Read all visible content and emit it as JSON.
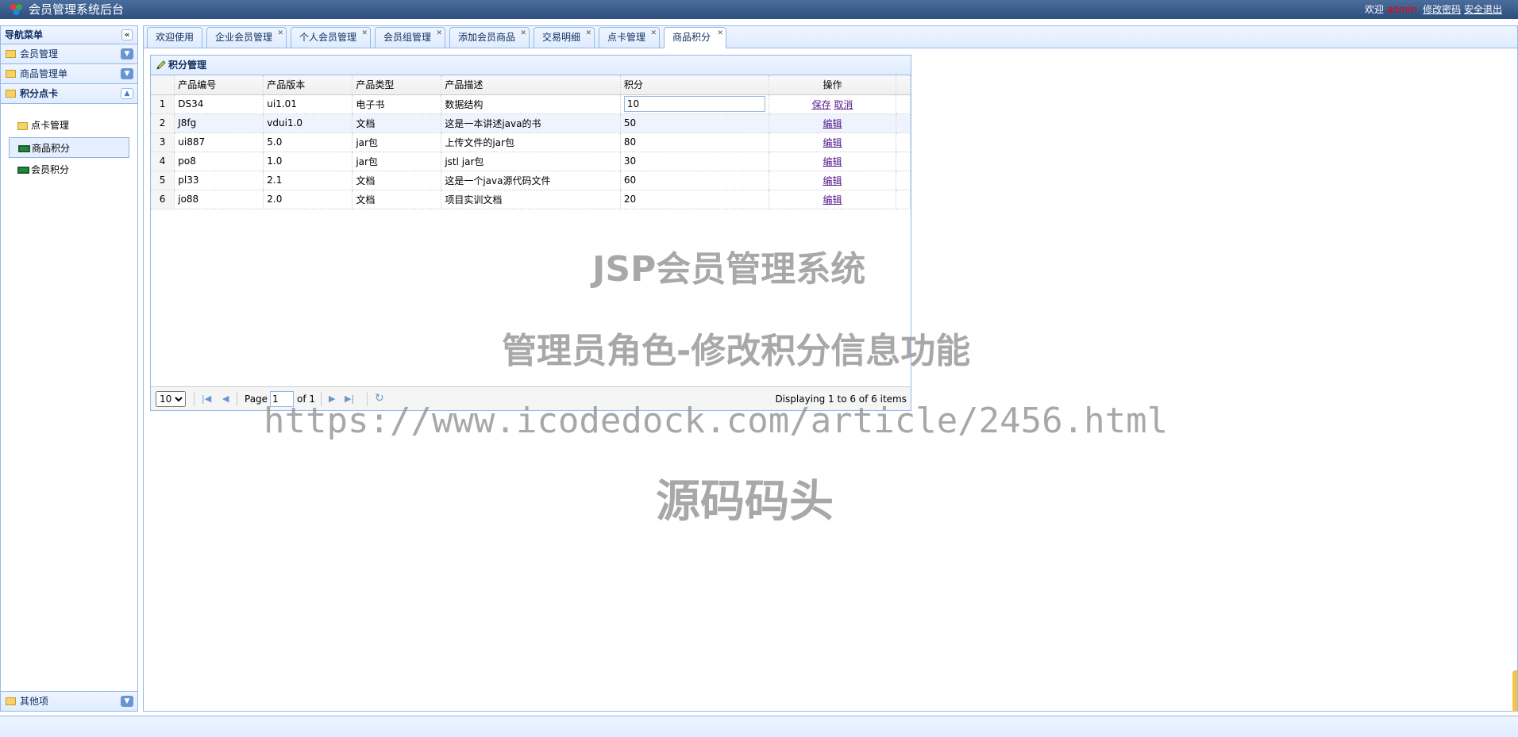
{
  "header": {
    "title": "会员管理系统后台",
    "welcome": "欢迎",
    "user": "admin",
    "change_password": "修改密码",
    "logout": "安全退出"
  },
  "nav": {
    "title": "导航菜单",
    "sections": [
      {
        "label": "会员管理"
      },
      {
        "label": "商品管理单"
      },
      {
        "label": "积分点卡"
      }
    ],
    "tree": [
      {
        "label": "点卡管理"
      },
      {
        "label": "商品积分"
      },
      {
        "label": "会员积分"
      }
    ],
    "other": "其他项"
  },
  "tabs": [
    {
      "label": "欢迎使用"
    },
    {
      "label": "企业会员管理"
    },
    {
      "label": "个人会员管理"
    },
    {
      "label": "会员组管理"
    },
    {
      "label": "添加会员商品"
    },
    {
      "label": "交易明细"
    },
    {
      "label": "点卡管理"
    },
    {
      "label": "商品积分"
    }
  ],
  "grid": {
    "title": "积分管理",
    "columns": [
      "产品编号",
      "产品版本",
      "产品类型",
      "产品描述",
      "积分",
      "操作"
    ],
    "rows": [
      {
        "n": "1",
        "code": "DS34",
        "version": "ui1.01",
        "type": "电子书",
        "desc": "数据结构",
        "points": "10"
      },
      {
        "n": "2",
        "code": "J8fg",
        "version": "vdui1.0",
        "type": "文档",
        "desc": "这是一本讲述java的书",
        "points": "50"
      },
      {
        "n": "3",
        "code": "ui887",
        "version": "5.0",
        "type": "jar包",
        "desc": "上传文件的jar包",
        "points": "80"
      },
      {
        "n": "4",
        "code": "po8",
        "version": "1.0",
        "type": "jar包",
        "desc": "jstl jar包",
        "points": "30"
      },
      {
        "n": "5",
        "code": "pl33",
        "version": "2.1",
        "type": "文档",
        "desc": "这是一个java源代码文件",
        "points": "60"
      },
      {
        "n": "6",
        "code": "jo88",
        "version": "2.0",
        "type": "文档",
        "desc": "项目实训文档",
        "points": "20"
      }
    ],
    "save": "保存",
    "cancel": "取消",
    "edit": "编辑",
    "pager": {
      "page_size": "10",
      "page_label": "Page",
      "page": "1",
      "of_label": "of 1",
      "display": "Displaying 1 to 6 of 6 items"
    }
  },
  "watermark": {
    "line1": "JSP会员管理系统",
    "line2": "管理员角色-修改积分信息功能",
    "line3": "https://www.icodedock.com/article/2456.html",
    "line4": "源码码头"
  }
}
